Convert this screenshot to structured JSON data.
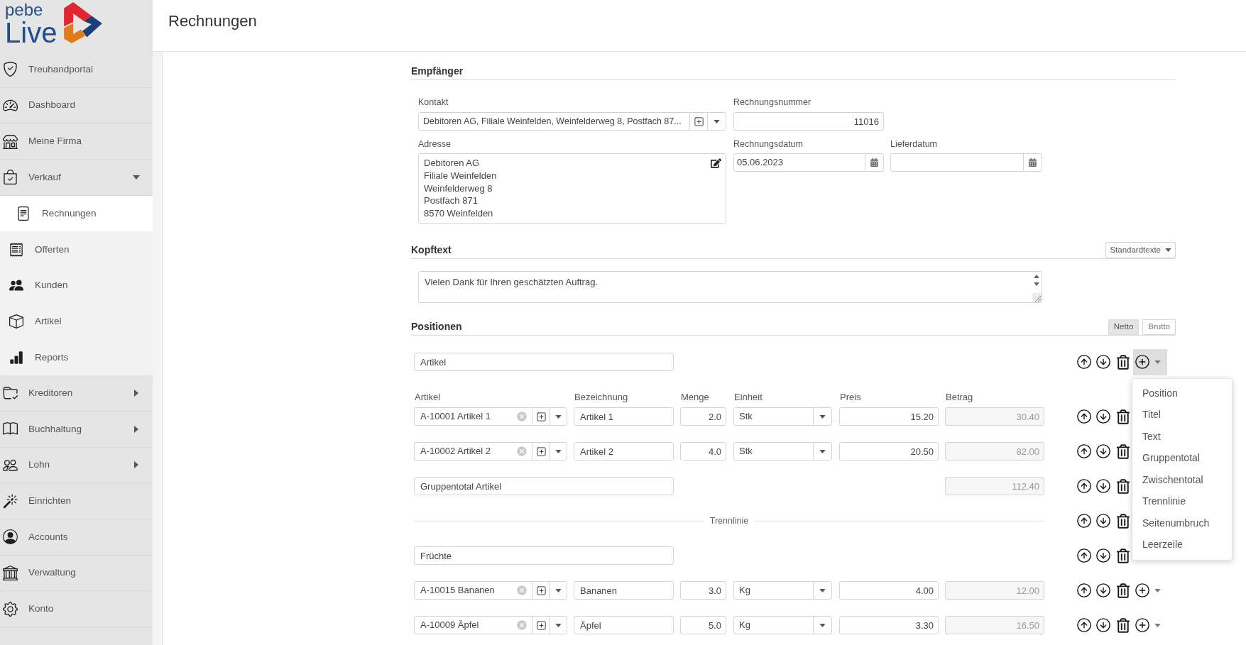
{
  "logo": {
    "line_1": "pebe",
    "line_2": "Live"
  },
  "sidebar": {
    "items": [
      {
        "label": "Treuhandportal",
        "kind": "link",
        "selected": false
      },
      {
        "label": "Dashboard",
        "kind": "link",
        "selected": false
      },
      {
        "label": "Meine Firma",
        "kind": "link",
        "selected": false
      },
      {
        "label": "Verkauf",
        "kind": "group",
        "expanded": true,
        "selected": false,
        "children": [
          {
            "label": "Rechnungen",
            "selected": true
          },
          {
            "label": "Offerten",
            "selected": false
          },
          {
            "label": "Kunden",
            "selected": false
          },
          {
            "label": "Artikel",
            "selected": false
          },
          {
            "label": "Reports",
            "selected": false
          }
        ]
      },
      {
        "label": "Kreditoren",
        "kind": "group",
        "expanded": false,
        "selected": false
      },
      {
        "label": "Buchhaltung",
        "kind": "group",
        "expanded": false,
        "selected": false
      },
      {
        "label": "Lohn",
        "kind": "group",
        "expanded": false,
        "selected": false
      },
      {
        "label": "Einrichten",
        "kind": "link",
        "selected": false
      },
      {
        "label": "Accounts",
        "kind": "link",
        "selected": false
      },
      {
        "label": "Verwaltung",
        "kind": "link",
        "selected": false
      },
      {
        "label": "Konto",
        "kind": "link",
        "selected": false
      }
    ]
  },
  "page_title": "Rechnungen",
  "recipient": {
    "title": "Empfänger",
    "contact": {
      "label": "Kontakt",
      "value": "Debitoren AG, Filiale Weinfelden, Weinfelderweg 8, Postfach 87..."
    },
    "invoice_number": {
      "label": "Rechnungsnummer",
      "value": "11016"
    },
    "address": {
      "label": "Adresse",
      "lines": [
        "Debitoren AG",
        "Filiale Weinfelden",
        "Weinfelderweg 8",
        "Postfach 871",
        "8570 Weinfelden"
      ]
    },
    "invoice_date": {
      "label": "Rechnungsdatum",
      "value": "05.06.2023"
    },
    "delivery_date": {
      "label": "Lieferdatum"
    }
  },
  "header_text": {
    "title": "Kopftext",
    "templates_button": "Standardtexte",
    "value": "Vielen Dank für Ihren geschätzten Auftrag."
  },
  "positions": {
    "title": "Positionen",
    "price_modes": [
      {
        "label": "Netto",
        "selected": true
      },
      {
        "label": "Brutto",
        "selected": false
      }
    ],
    "rows": [
      {
        "kind": "title",
        "value": "Artikel",
        "add_button": true,
        "menu_open": true
      },
      {
        "kind": "column_headers",
        "columns": [
          "Artikel",
          "Bezeichnung",
          "Menge",
          "Einheit",
          "Preis",
          "Betrag"
        ]
      },
      {
        "kind": "item",
        "article": "A-10001 Artikel 1",
        "description": "Artikel 1",
        "quantity": "2.0",
        "unit": "Stk",
        "price": "15.20",
        "amount": "30.40",
        "add_button": false,
        "menu_open": false
      },
      {
        "kind": "item",
        "article": "A-10002 Artikel 2",
        "description": "Artikel 2",
        "quantity": "4.0",
        "unit": "Stk",
        "price": "20.50",
        "amount": "82.00",
        "add_button": false,
        "menu_open": false
      },
      {
        "kind": "group_total",
        "value": "Gruppentotal Artikel",
        "amount": "112.40",
        "add_button": false,
        "menu_open": false
      },
      {
        "kind": "separator",
        "label": "Trennlinie",
        "add_button": false,
        "menu_open": false
      },
      {
        "kind": "title",
        "value": "Früchte",
        "add_button": false,
        "menu_open": false
      },
      {
        "kind": "item",
        "article": "A-10015 Bananen",
        "description": "Bananen",
        "quantity": "3.0",
        "unit": "Kg",
        "price": "4.00",
        "amount": "12.00",
        "add_button": true,
        "menu_open": false
      },
      {
        "kind": "item",
        "article": "A-10009 Äpfel",
        "description": "Äpfel",
        "quantity": "5.0",
        "unit": "Kg",
        "price": "3.30",
        "amount": "16.50",
        "add_button": true,
        "menu_open": false
      }
    ],
    "add_menu": {
      "items": [
        "Position",
        "Titel",
        "Text",
        "Gruppentotal",
        "Zwischentotal",
        "Trennlinie",
        "Seitenumbruch",
        "Leerzeile"
      ]
    }
  }
}
